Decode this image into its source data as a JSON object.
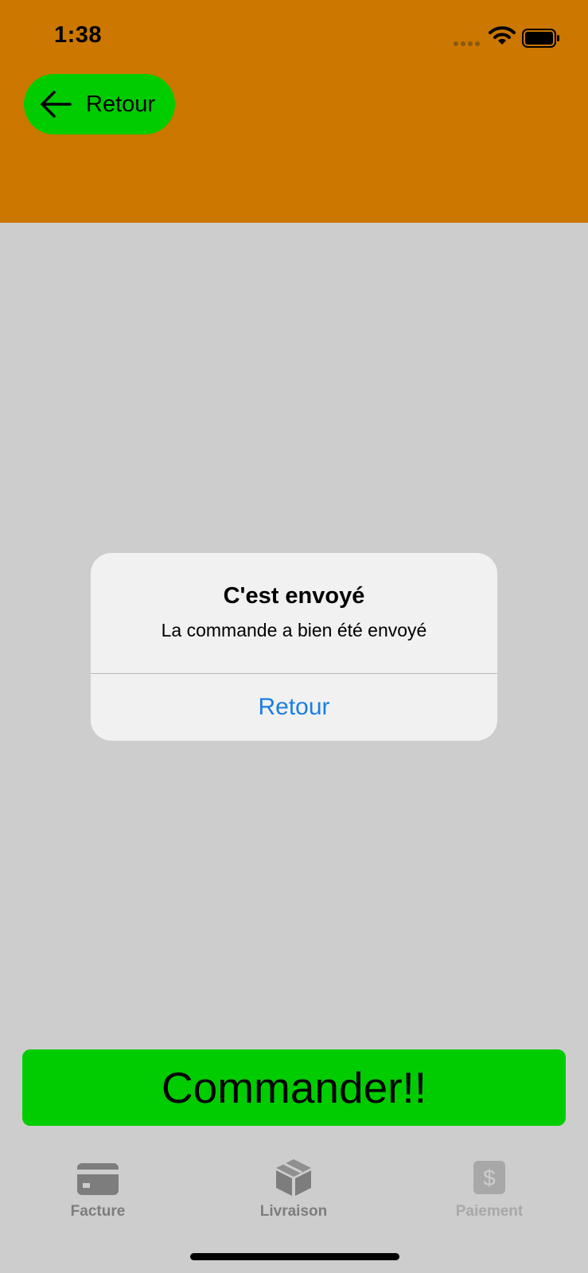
{
  "status_bar": {
    "time": "1:38",
    "icons": [
      "signal-icon",
      "wifi-icon",
      "battery-icon"
    ]
  },
  "header": {
    "back_button": {
      "label": "Retour",
      "icon": "arrow-left-icon"
    },
    "background_color": "#cc7700",
    "button_color": "#00cc00"
  },
  "alert": {
    "title": "C'est envoyé",
    "message": "La commande a bien été envoyé",
    "action_label": "Retour",
    "action_color": "#1a7fe0"
  },
  "order_button": {
    "label": "Commander!!",
    "color": "#00cc00"
  },
  "tab_bar": {
    "items": [
      {
        "label": "Facture",
        "icon": "credit-card-icon"
      },
      {
        "label": "Livraison",
        "icon": "package-icon"
      },
      {
        "label": "Paiement",
        "icon": "dollar-icon"
      }
    ]
  }
}
